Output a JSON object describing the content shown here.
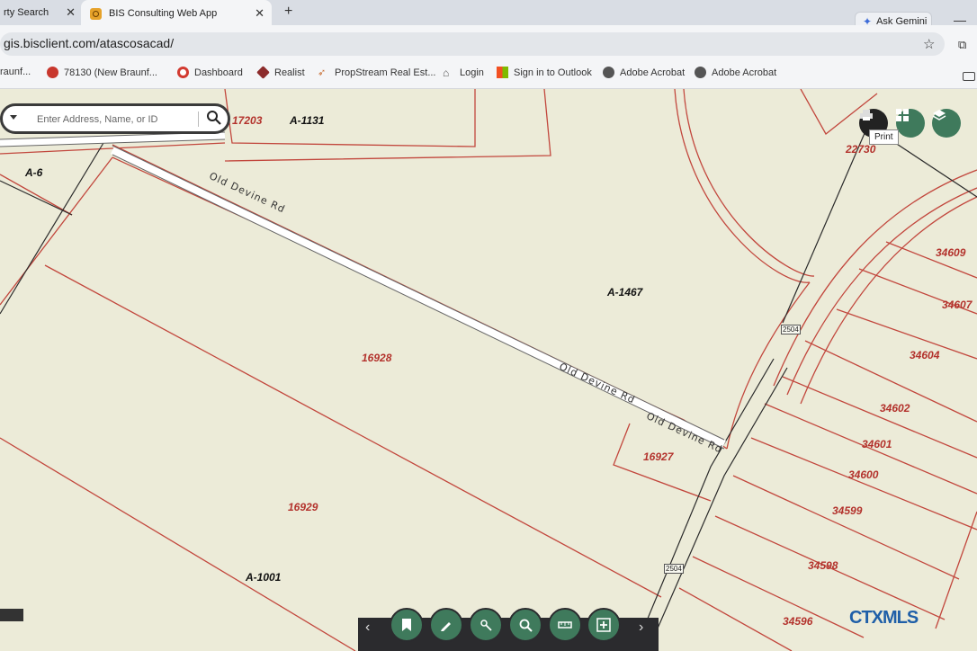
{
  "browser": {
    "tabs": [
      {
        "label": "rty Search",
        "active": false
      },
      {
        "label": "BIS Consulting Web App",
        "active": true
      }
    ],
    "new_tab": "+",
    "gemini_label": "Ask Gemini",
    "url": "gis.bisclient.com/atascosacad/",
    "bookmarks": [
      {
        "label": "raunf...",
        "icon": "bookmark-icon"
      },
      {
        "label": "78130 (New Braunf...",
        "icon": "flower-icon"
      },
      {
        "label": "Dashboard",
        "icon": "target-icon"
      },
      {
        "label": "Realist",
        "icon": "cube-icon"
      },
      {
        "label": "PropStream Real Est...",
        "icon": "propstream-icon"
      },
      {
        "label": "Login",
        "icon": "home-icon"
      },
      {
        "label": "Sign in to Outlook",
        "icon": "microsoft-icon"
      },
      {
        "label": "Adobe Acrobat",
        "icon": "globe-icon"
      },
      {
        "label": "Adobe Acrobat",
        "icon": "globe-icon"
      }
    ]
  },
  "search": {
    "placeholder": "Enter Address, Name, or ID"
  },
  "tooltip": "Print",
  "map": {
    "parcels": [
      "17203",
      "16928",
      "16927",
      "16929",
      "22730",
      "34609",
      "34607",
      "34604",
      "34602",
      "34601",
      "34600",
      "34599",
      "34598",
      "34596"
    ],
    "abstracts": [
      "A-1131",
      "A-6",
      "A-1467",
      "A-1001"
    ],
    "roads": [
      "Old Devine Rd",
      "Old Devine Rd",
      "Old Devine Rd"
    ],
    "highway_shields": [
      "2504",
      "2504"
    ]
  },
  "toolbar": {
    "buttons": [
      "bookmark-icon",
      "pencil-icon",
      "identify-icon",
      "search-area-icon",
      "measure-icon",
      "add-layer-icon"
    ],
    "prev": "‹",
    "next": "›"
  },
  "watermark": "CTXMLS"
}
